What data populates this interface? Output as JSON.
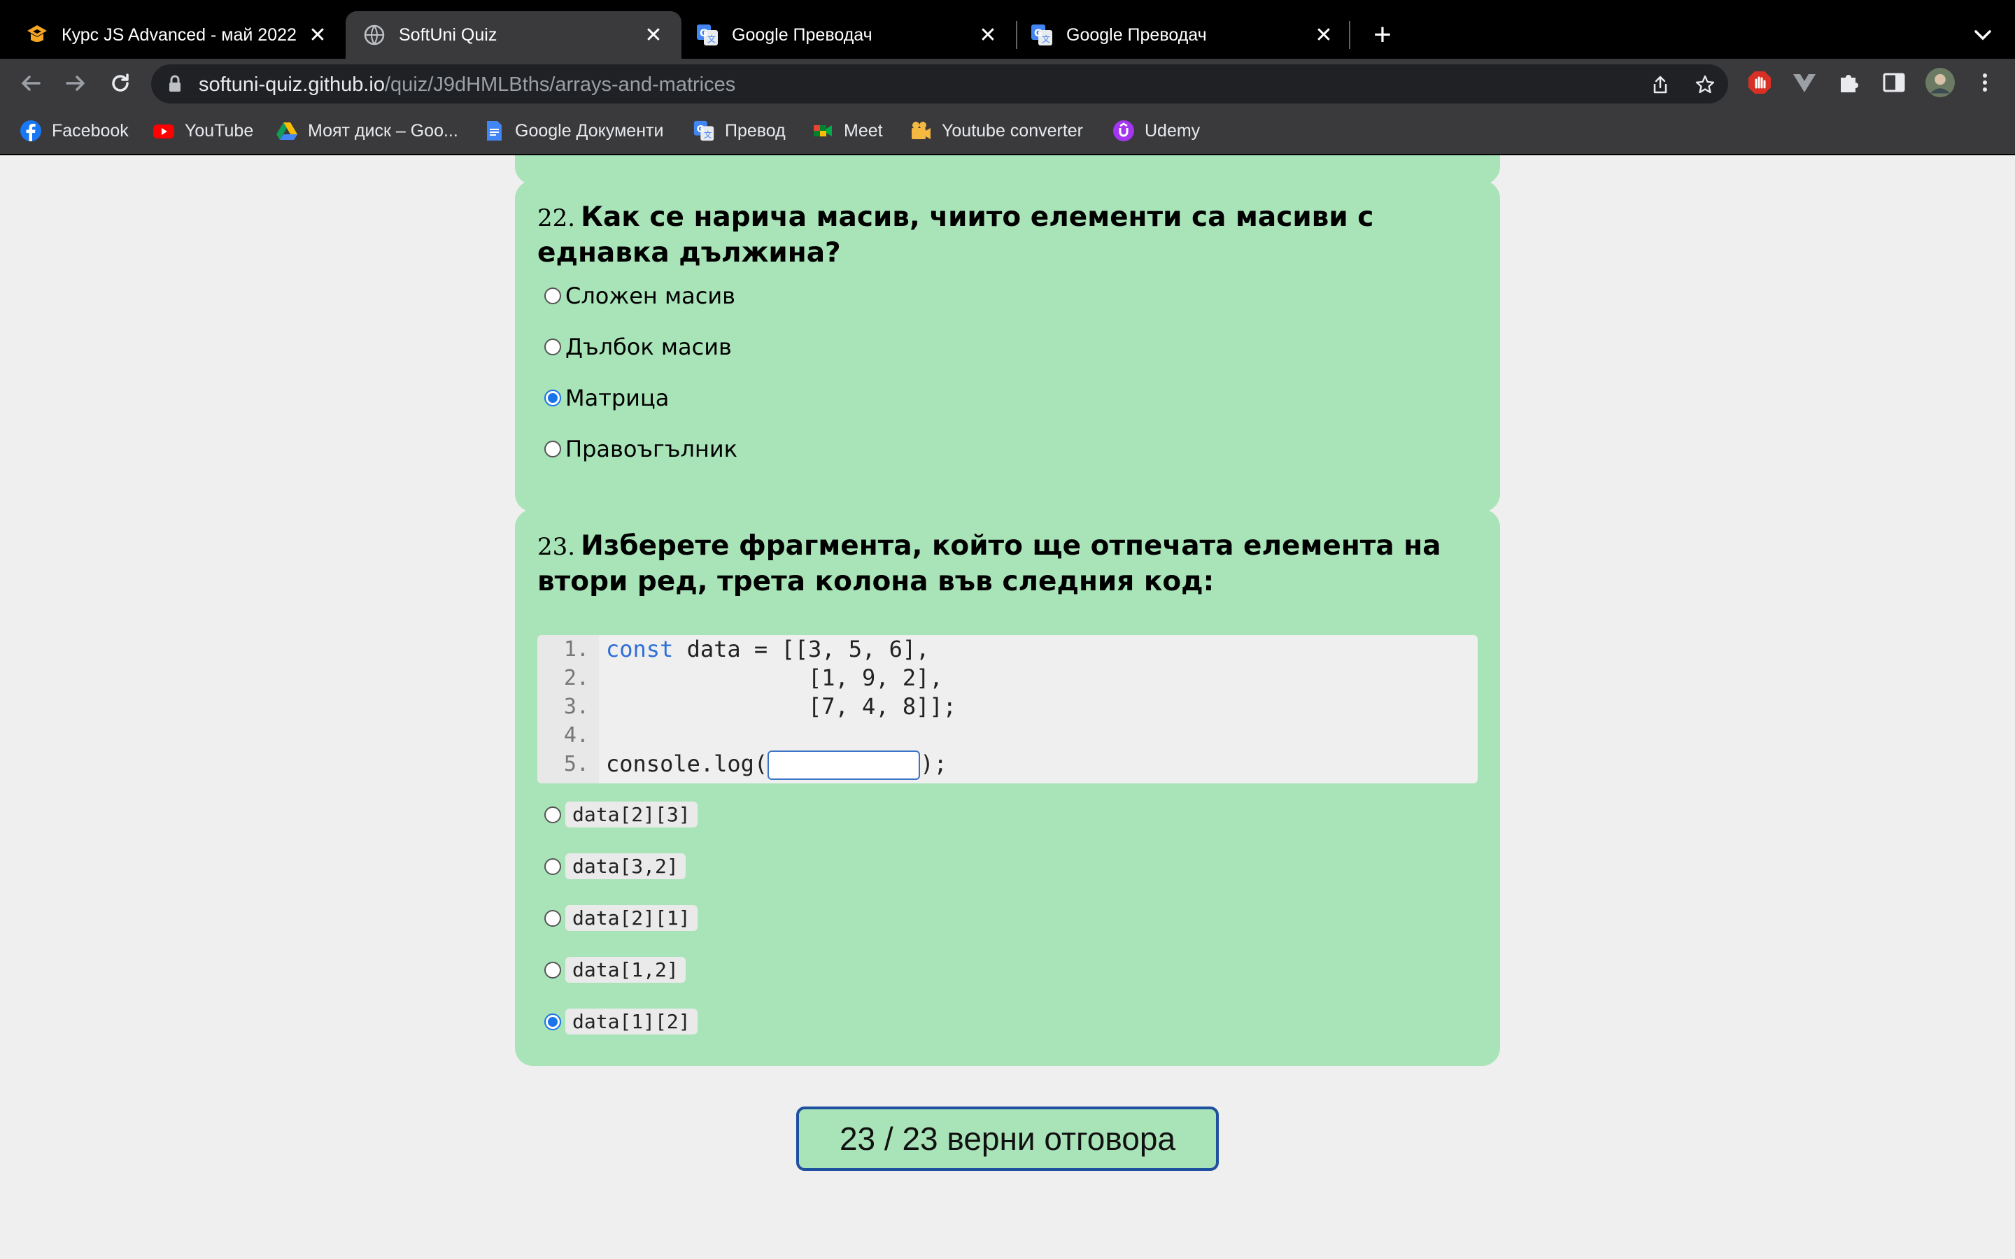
{
  "browser": {
    "tabs": [
      {
        "title": "Курс JS Advanced - май 2022",
        "icon": "softuni-logo-icon"
      },
      {
        "title": "SoftUni Quiz",
        "icon": "globe-icon",
        "active": true
      },
      {
        "title": "Google Преводач",
        "icon": "google-translate-icon"
      },
      {
        "title": "Google Преводач",
        "icon": "google-translate-icon"
      }
    ],
    "url_host": "softuni-quiz.github.io",
    "url_path": "/quiz/J9dHMLBths/arrays-and-matrices",
    "bookmarks": [
      {
        "label": "Facebook",
        "icon": "facebook-icon"
      },
      {
        "label": "YouTube",
        "icon": "youtube-icon"
      },
      {
        "label": "Моят диск – Goo...",
        "icon": "google-drive-icon"
      },
      {
        "label": "Google Документи",
        "icon": "google-docs-icon"
      },
      {
        "label": "Превод",
        "icon": "google-translate-icon"
      },
      {
        "label": "Meet",
        "icon": "google-meet-icon"
      },
      {
        "label": "Youtube converter",
        "icon": "converter-icon"
      },
      {
        "label": "Udemy",
        "icon": "udemy-icon"
      }
    ]
  },
  "questions": [
    {
      "number": "22.",
      "text": "Как се нарича масив, чиито елементи са масиви с еднавка дължина?",
      "options": [
        {
          "label": "Сложен масив",
          "checked": false
        },
        {
          "label": "Дълбок масив",
          "checked": false
        },
        {
          "label": "Матрица",
          "checked": true
        },
        {
          "label": "Правоъгълник",
          "checked": false
        }
      ]
    },
    {
      "number": "23.",
      "text": "Изберете фрагмента, който ще отпечата елемента на втори ред, трета колона във следния код:",
      "code": {
        "line_numbers": [
          "1.",
          "2.",
          "3.",
          "4.",
          "5."
        ],
        "keyword": "const",
        "line1_rest": " data = [[3, 5, 6],",
        "line2": "               [1, 9, 2],",
        "line3": "               [7, 4, 8]];",
        "line5_prefix": "console.log(",
        "line5_suffix": ");"
      },
      "options": [
        {
          "label": "data[2][3]",
          "checked": false
        },
        {
          "label": "data[3,2]",
          "checked": false
        },
        {
          "label": "data[2][1]",
          "checked": false
        },
        {
          "label": "data[1,2]",
          "checked": false
        },
        {
          "label": "data[1][2]",
          "checked": true
        }
      ]
    }
  ],
  "score": "23 / 23 верни отговора",
  "colors": {
    "card": "#a9e4b9",
    "page_bg": "#efefef",
    "radio_checked": "#1a73e8",
    "score_border": "#1f4f9f",
    "keyword": "#2f6fd6"
  }
}
